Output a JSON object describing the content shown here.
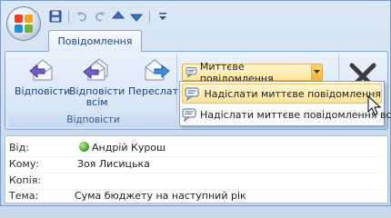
{
  "qat": {
    "icons": [
      "save-icon",
      "undo-icon",
      "redo-icon",
      "up-arrow-icon",
      "down-arrow-icon",
      "customize-icon"
    ]
  },
  "tab": {
    "label": "Повідомлення"
  },
  "ribbon": {
    "reply_label": "Відповісти",
    "reply_all_label_1": "Відповісти",
    "reply_all_label_2": "всім",
    "forward_label": "Переслати",
    "group_label": "Відповісти",
    "im_dropdown_label": "Миттєве повідомлення"
  },
  "menu": {
    "items": [
      {
        "label": "Надіслати миттєве повідомлення",
        "highlighted": true
      },
      {
        "label": "Надіслати миттєве повідомлення всім",
        "highlighted": false
      }
    ]
  },
  "header": {
    "from_label": "Від:",
    "from_value": "Андрій Курош",
    "to_label": "Кому:",
    "to_value": "Зоя Лисицька",
    "cc_label": "Копія:",
    "cc_value": "",
    "subject_label": "Тема:",
    "subject_value": "Сума бюджету на наступний рік"
  },
  "colors": {
    "accent": "#15428b",
    "highlight": "#ffe396",
    "presence": "#3b9a21"
  }
}
